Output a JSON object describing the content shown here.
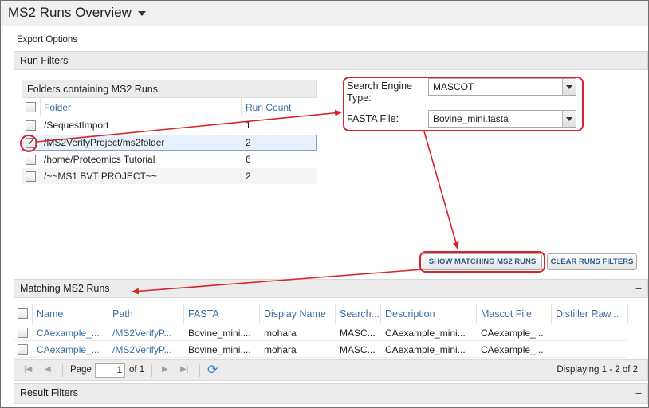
{
  "page": {
    "title": "MS2 Runs Overview",
    "export_options": "Export Options"
  },
  "run_filters": {
    "header": "Run Filters",
    "folders_grid": {
      "title": "Folders containing MS2 Runs",
      "columns": {
        "folder": "Folder",
        "run_count": "Run Count"
      },
      "rows": [
        {
          "folder": "/SequestImport",
          "run_count": "1",
          "checked": false
        },
        {
          "folder": "/MS2VerifyProject/ms2folder",
          "run_count": "2",
          "checked": true
        },
        {
          "folder": "/home/Proteomics Tutorial",
          "run_count": "6",
          "checked": false
        },
        {
          "folder": "/~~MS1 BVT PROJECT~~",
          "run_count": "2",
          "checked": false
        }
      ]
    },
    "search_engine_label_line1": "Search Engine",
    "search_engine_label_line2": "Type:",
    "search_engine_value": "MASCOT",
    "fasta_label": "FASTA File:",
    "fasta_value": "Bovine_mini.fasta",
    "show_button": "SHOW MATCHING MS2 RUNS",
    "clear_button": "CLEAR RUNS FILTERS"
  },
  "matching_runs": {
    "header": "Matching MS2 Runs",
    "columns": {
      "name": "Name",
      "path": "Path",
      "fasta": "FASTA",
      "display_name": "Display Name",
      "search": "Search...",
      "description": "Description",
      "mascot_file": "Mascot File",
      "distiller": "Distiller Raw..."
    },
    "rows": [
      {
        "name": "CAexample_...",
        "path": "/MS2VerifyP...",
        "fasta": "Bovine_mini....",
        "display_name": "mohara",
        "search": "MASC...",
        "description": "CAexample_mini...",
        "mascot_file": "CAexample_..."
      },
      {
        "name": "CAexample_...",
        "path": "/MS2VerifyP...",
        "fasta": "Bovine_mini....",
        "display_name": "mohara",
        "search": "MASC...",
        "description": "CAexample_mini...",
        "mascot_file": "CAexample_..."
      }
    ],
    "pager": {
      "page_label": "Page",
      "page_value": "1",
      "of_label": "of 1",
      "displaying": "Displaying 1 - 2 of 2"
    }
  },
  "result_filters": {
    "header": "Result Filters"
  },
  "colors": {
    "annotation_red": "#d8232a",
    "link_blue": "#3a6e9f"
  }
}
